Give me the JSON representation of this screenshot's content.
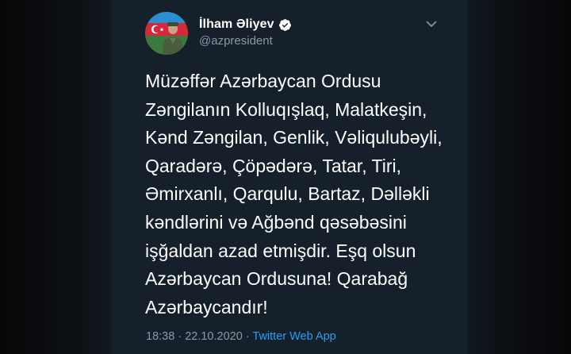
{
  "author": {
    "display_name": "İlham Əliyev",
    "handle": "@azpresident",
    "verified": true,
    "avatar_icon": "profile-photo-with-flag"
  },
  "tweet": {
    "lines": [
      "Müzəffər Azərbaycan Ordusu",
      "Zəngilanın Kolluqışlaq, Malatkeşin,",
      "Kənd Zəngilan, Genlik, Vəliqulubəyli,",
      "Qaradərə, Çöpədərə, Tatar, Tiri,",
      "Əmirxanlı, Qarqulu, Bartaz, Dəlləkli",
      "kəndlərini və Ağbənd qəsəbəsini",
      "işğaldan azad etmişdir. Eşq olsun",
      "Azərbaycan Ordusuna! Qarabağ",
      "Azərbaycandır!"
    ]
  },
  "meta": {
    "time": "18:38",
    "separator": " · ",
    "date": "22.10.2020",
    "source": "Twitter Web App"
  },
  "menu_icon": "chevron-down-icon",
  "colors": {
    "background": "#15202b",
    "secondary_text": "#8899a6",
    "link": "#1da1f2",
    "verified_badge": "#ffffff"
  }
}
